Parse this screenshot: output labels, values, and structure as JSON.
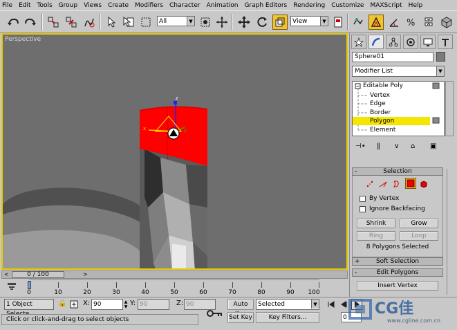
{
  "menu": [
    "File",
    "Edit",
    "Tools",
    "Group",
    "Views",
    "Create",
    "Modifiers",
    "Character",
    "Animation",
    "Graph Editors",
    "Rendering",
    "Customize",
    "MAXScript",
    "Help"
  ],
  "toolbar": {
    "undo_icon": "undo-icon",
    "redo_icon": "redo-icon",
    "selection_filter": "All",
    "ref_coord": "View"
  },
  "viewport": {
    "label": "Perspective",
    "gizmo_z": "z",
    "gizmo_x": "x",
    "gizmo_y": "y",
    "selection_color": "#ff0000",
    "background_color": "#6e6e6e"
  },
  "command_panel": {
    "object_name": "Sphere01",
    "modifier_list": "Modifier List",
    "stack": {
      "root": "Editable Poly",
      "subobjects": [
        "Vertex",
        "Edge",
        "Border",
        "Polygon",
        "Element"
      ],
      "selected": "Polygon"
    },
    "selection_rollout": {
      "title": "Selection",
      "toggle": "-",
      "by_vertex": "By Vertex",
      "ignore_backfacing": "Ignore Backfacing",
      "shrink": "Shrink",
      "grow": "Grow",
      "ring": "Ring",
      "loop": "Loop",
      "status": "8 Polygons Selected"
    },
    "soft_selection": {
      "title": "Soft Selection",
      "toggle": "+"
    },
    "edit_polygons": {
      "title": "Edit Polygons",
      "toggle": "-",
      "insert_vertex": "Insert Vertex"
    }
  },
  "timeline": {
    "frame_display": "0 / 100",
    "ticks": [
      "0",
      "10",
      "20",
      "30",
      "40",
      "50",
      "60",
      "70",
      "80",
      "90",
      "100"
    ]
  },
  "status": {
    "selection_count": "1 Object Selecte",
    "x_label": "X:",
    "x_value": "90",
    "y_label": "Y:",
    "y_value": "90",
    "z_label": "Z:",
    "z_value": "90",
    "auto_key": "Auto Key",
    "key_filter_select": "Selected",
    "set_key": "Set Key",
    "key_filters": "Key Filters...",
    "prompt": "Click or click-and-drag to select objects",
    "frame_field": "0"
  },
  "watermark": {
    "brand": "CG佳",
    "url": "www.cgline.com.cn"
  }
}
